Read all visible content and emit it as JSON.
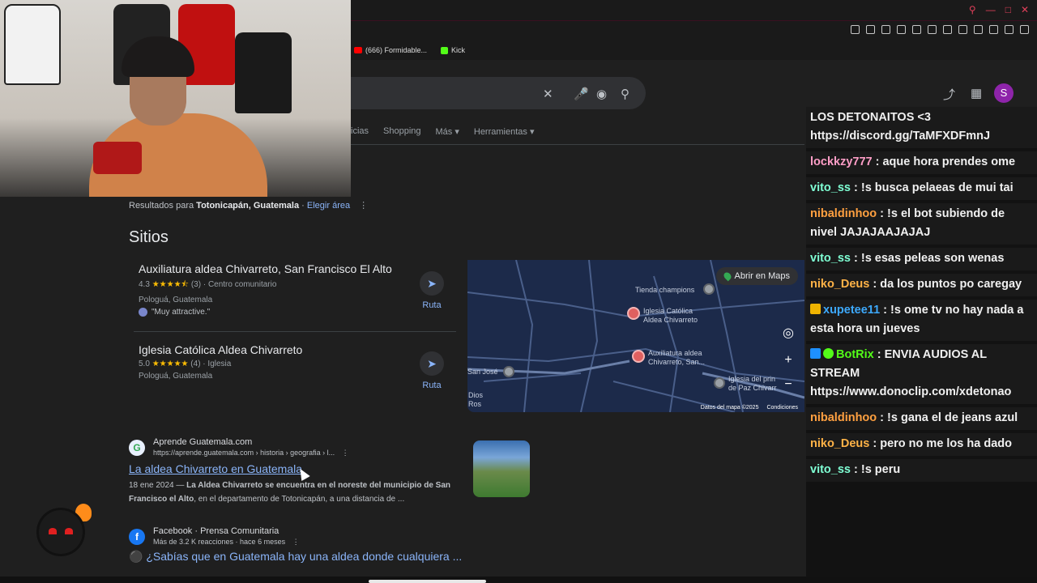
{
  "bookmarks": [
    {
      "label": "(666) Formidable...",
      "color": "#ff0000"
    },
    {
      "label": "Kick",
      "color": "#53fc18"
    }
  ],
  "search": {
    "clear_icon": "close-icon",
    "mic_icon": "mic-icon",
    "lens_icon": "lens-icon",
    "search_icon": "search-icon"
  },
  "header": {
    "avatar_letter": "S"
  },
  "tabs": [
    "icias",
    "Shopping",
    "Más",
    "Herramientas"
  ],
  "results_for": {
    "prefix": "Resultados para",
    "location": "Totonicapán, Guatemala",
    "sep": " · ",
    "change": "Elegir área"
  },
  "sitios": {
    "heading": "Sitios",
    "places": [
      {
        "name": "Auxiliatura aldea Chivarreto, San Francisco El Alto",
        "rating": "4.3",
        "stars": "★★★★⯪",
        "count": "(3)",
        "category": "Centro comunitario",
        "address": "Pologuá, Guatemala",
        "review": "\"Muy attractive.\"",
        "route": "Ruta"
      },
      {
        "name": "Iglesia Católica Aldea Chivarreto",
        "rating": "5.0",
        "stars": "★★★★★",
        "count": "(4)",
        "category": "Iglesia",
        "address": "Pologuá, Guatemala",
        "review": "",
        "route": "Ruta"
      }
    ]
  },
  "map": {
    "open_label": "Abrir en Maps",
    "labels": {
      "tienda": "Tienda champions",
      "iglesia": "Iglesia Católica\nAldea Chivarreto",
      "auxiliatura": "Auxiliatura aldea\nChivarreto, San...",
      "sanjose": "San José",
      "dios": "Dios\nRos",
      "iglesia_paz": "Iglesia del prin\nde Paz Chivarr"
    },
    "footer_data": "Datos del mapa ©2025",
    "footer_terms": "Condiciones"
  },
  "results": [
    {
      "favicon": "G",
      "favicon_color": "#34a853",
      "site": "Aprende Guatemala.com",
      "url": "https://aprende.guatemala.com › historia › geografia › l...",
      "title": "La aldea Chivarreto en Guatemala",
      "date": "18 ene 2024 — ",
      "snippet_bold": "La Aldea Chivarreto se encuentra en el noreste del municipio de San Francisco el Alto",
      "snippet_rest": ", en el departamento de Totonicapán, a una distancia de ..."
    },
    {
      "favicon": "f",
      "favicon_color": "#1877f2",
      "site": "Facebook · Prensa Comunitaria",
      "url": "Más de 3.2 K reacciones · hace 6 meses",
      "title": "¿Sabías que en Guatemala hay una aldea donde cualquiera ..."
    }
  ],
  "chat": [
    {
      "user": "",
      "text": "LOS DETONAITOS <3 https://discord.gg/TaMFXDFmnJ",
      "color": "#ffffff",
      "badge": ""
    },
    {
      "user": "lockkzy777",
      "text": " : aque hora prendes ome",
      "color": "#ff9ec7",
      "badge": ""
    },
    {
      "user": "vito_ss",
      "text": " : !s busca pelaeas de mui tai",
      "color": "#7fffd4",
      "badge": ""
    },
    {
      "user": "nibaldinhoo",
      "text": " : !s el bot subiendo de nivel JAJAJAAJAJAJ",
      "color": "#ffa040",
      "badge": ""
    },
    {
      "user": "vito_ss",
      "text": " : !s esas peleas son wenas",
      "color": "#7fffd4",
      "badge": ""
    },
    {
      "user": "niko_Deus",
      "text": " : da los puntos po caregay",
      "color": "#ffb347",
      "badge": ""
    },
    {
      "user": "xupetee11",
      "text": " : !s ome tv no hay nada a esta hora un jueves",
      "color": "#3da9fc",
      "badge": "crown"
    },
    {
      "user": "BotRix",
      "text": " : ENVIA AUDIOS AL STREAM https://www.donoclip.com/xdetonao",
      "color": "#53fc18",
      "badge": "bot"
    },
    {
      "user": "nibaldinhoo",
      "text": " : !s gana el de jeans azul",
      "color": "#ffa040",
      "badge": ""
    },
    {
      "user": "niko_Deus",
      "text": " : pero no me los ha dado",
      "color": "#ffb347",
      "badge": ""
    },
    {
      "user": "vito_ss",
      "text": " : !s peru",
      "color": "#7fffd4",
      "badge": ""
    }
  ]
}
